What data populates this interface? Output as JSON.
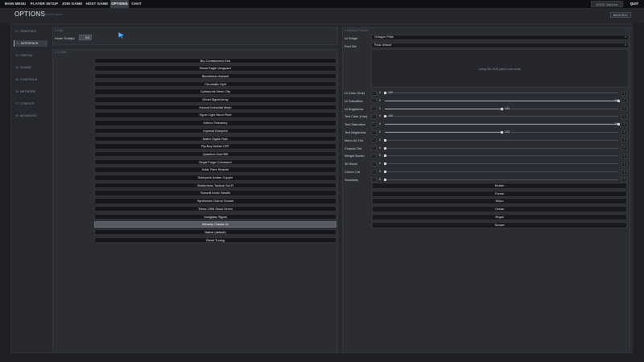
{
  "nav": [
    "MAIN MENU",
    "PLAYER SETUP",
    "JOIN GAME",
    "HOST GAME",
    "OPTIONS",
    "CHAT"
  ],
  "mode_label": "MODE: Warzone",
  "quit_label": "QUIT",
  "title": "OPTIONS",
  "subtitle": "Interface Layout",
  "back_label": "BACK/ESC",
  "sidebar": [
    {
      "num": "01",
      "label": "GRAPHICS"
    },
    {
      "num": "02",
      "label": "INTERFACE"
    },
    {
      "num": "03",
      "label": "DISPLAY"
    },
    {
      "num": "04",
      "label": "SOUND"
    },
    {
      "num": "05",
      "label": "CONTROLS"
    },
    {
      "num": "06",
      "label": "NETWORK"
    },
    {
      "num": "07",
      "label": "CONFIGS"
    },
    {
      "num": "08",
      "label": "ADVANCED"
    }
  ],
  "help_panel": {
    "title": "// Help",
    "hover_tooltips_label": "Hover Tooltips",
    "toggle_value": "ON"
  },
  "ui_skin": {
    "title": "// UI Skin",
    "themes": [
      "Bio-Containment Grid",
      "Blood Eagle Vanguard",
      "Bloodmoon Assault",
      "Chromatic Split",
      "Cyberpunk Neon City",
      "Ghost Signal Array",
      "Hazard Industrial Mesh",
      "Hyper Light Neon Pixel",
      "Inferno Telemetry",
      "Imperial Blueprint",
      "Matrix Digital Rain",
      "Pip-Boy Amber CRT",
      "Quantum Void Rift",
      "Royal Forge Command",
      "Solar Flare Reactor",
      "Solarpunk Amber Copper",
      "Starfortress Tactical Sci-Fi",
      "Stanwill Arctic Stealth",
      "Synthwave Outrun Sunset",
      "Tribes 1998 Stock Green",
      "Voidglass Signal",
      "Winamp Classic 2x",
      "Native (default)",
      "Reset Tuning"
    ],
    "selected": "Winamp Classic 2x"
  },
  "interface_theme": {
    "title": "// Interface Theme",
    "ui_shape_label": "UI Shape",
    "ui_shape_value": "Octagon Plate",
    "font_set_label": "Font Set",
    "font_set_value": "Pack default",
    "preview_text": "using this HUD pack's own fonts",
    "sliders": [
      {
        "label": "UI Color (Hue)",
        "value": "0",
        "max": "100",
        "fraction": 0.0
      },
      {
        "label": "UI Saturation",
        "value": "0",
        "max": "100",
        "fraction": 1.0
      },
      {
        "label": "UI Brightness",
        "value": "0",
        "max": "100",
        "fraction": 0.5
      },
      {
        "label": "Text Color (Hue)",
        "value": "0",
        "max": "100",
        "fraction": 0.0
      },
      {
        "label": "Text Saturation",
        "value": "0",
        "max": "100",
        "fraction": 1.0
      },
      {
        "label": "Text Brightness",
        "value": "0",
        "max": "100",
        "fraction": 0.5
      },
      {
        "label": "Menu Art Tint",
        "value": "0",
        "max": "",
        "fraction": 0.0
      },
      {
        "label": "Chassis Tint",
        "value": "0",
        "max": "",
        "fraction": 0.0
      },
      {
        "label": "Widget Border",
        "value": "0",
        "max": "",
        "fraction": 0.0
      },
      {
        "label": "3D Bevel",
        "value": "0",
        "max": "",
        "fraction": 0.0
      },
      {
        "label": "Corner Cut",
        "value": "0",
        "max": "",
        "fraction": 0.0
      },
      {
        "label": "Scanlines",
        "value": "0",
        "max": "",
        "fraction": 0.0
      }
    ],
    "presets": [
      "Ember",
      "Forest",
      "Mono",
      "Ocean",
      "Royal",
      "Sunset"
    ]
  }
}
